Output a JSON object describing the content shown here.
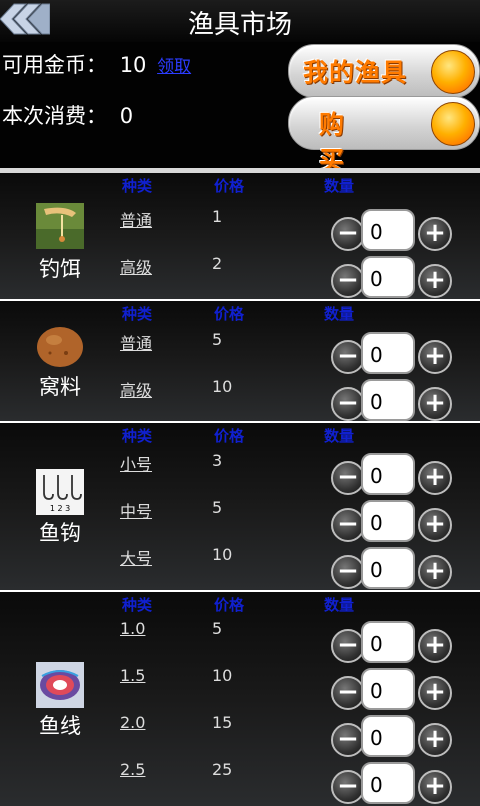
{
  "header": {
    "title": "渔具市场"
  },
  "info": {
    "coins_label": "可用金币：",
    "coins_value": "10",
    "claim_link": "领取",
    "spend_label": "本次消费：",
    "spend_value": "0"
  },
  "buttons": {
    "my_gear": "我的渔具",
    "buy": "购 买"
  },
  "columns": {
    "kind": "种类",
    "price": "价格",
    "qty": "数量"
  },
  "sections": [
    {
      "name": "钓饵",
      "icon": "bait-icon",
      "rows": [
        {
          "kind": "普通",
          "price": "1",
          "qty": "0"
        },
        {
          "kind": "高级",
          "price": "2",
          "qty": "0"
        }
      ]
    },
    {
      "name": "窝料",
      "icon": "groundbait-ball-icon",
      "rows": [
        {
          "kind": "普通",
          "price": "5",
          "qty": "0"
        },
        {
          "kind": "高级",
          "price": "10",
          "qty": "0"
        }
      ]
    },
    {
      "name": "鱼钩",
      "icon": "fishhooks-icon",
      "rows": [
        {
          "kind": "小号",
          "price": "3",
          "qty": "0"
        },
        {
          "kind": "中号",
          "price": "5",
          "qty": "0"
        },
        {
          "kind": "大号",
          "price": "10",
          "qty": "0"
        }
      ]
    },
    {
      "name": "鱼线",
      "icon": "fishing-line-spool-icon",
      "rows": [
        {
          "kind": "1.0",
          "price": "5",
          "qty": "0"
        },
        {
          "kind": "1.5",
          "price": "10",
          "qty": "0"
        },
        {
          "kind": "2.0",
          "price": "15",
          "qty": "0"
        },
        {
          "kind": "2.5",
          "price": "25",
          "qty": "0"
        }
      ]
    }
  ],
  "hook_sizes_label": "1 2 3",
  "stepper": {
    "minus": "−",
    "plus": "+"
  },
  "colors": {
    "accent_orange": "#ff7b00",
    "header_blue": "#1020d0",
    "link_blue": "#2b3cff"
  }
}
